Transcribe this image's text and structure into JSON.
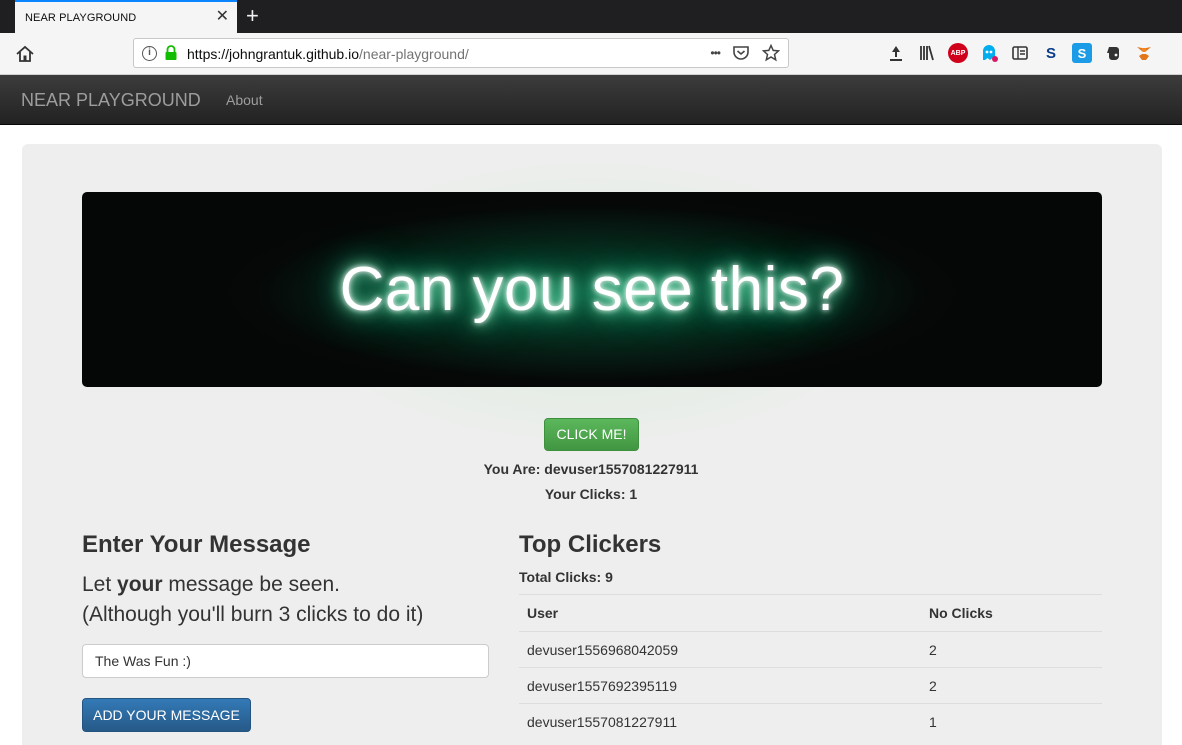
{
  "browser": {
    "tab_title": "NEAR PLAYGROUND",
    "tab_close": "✕",
    "new_tab": "+",
    "url_host": "https://johngrantuk.github.io",
    "url_path": "/near-playground/",
    "url_actions": [
      "•••",
      "pocket-icon",
      "star-icon"
    ],
    "extensions": [
      "download-icon",
      "library-icon",
      "adblock-icon",
      "ghostery-icon",
      "reader-icon",
      "s-icon",
      "s-blue-icon",
      "evernote-icon",
      "metamask-icon"
    ]
  },
  "navbar": {
    "brand": "NEAR PLAYGROUND",
    "about": "About"
  },
  "hero": {
    "banner_text": "Can you see this?",
    "click_button": "CLICK ME!",
    "you_are": "You Are: devuser1557081227911",
    "your_clicks": "Your Clicks: 1"
  },
  "message": {
    "title": "Enter Your Message",
    "sub1_pre": "Let ",
    "sub1_bold": "your",
    "sub1_post": " message be seen.",
    "sub2": "(Although you'll burn 3 clicks to do it)",
    "input_value": "The Was Fun :)",
    "add_button": "ADD YOUR MESSAGE"
  },
  "clickers": {
    "title": "Top Clickers",
    "total": "Total Clicks: 9",
    "headers": [
      "User",
      "No Clicks"
    ],
    "rows": [
      {
        "user": "devuser1556968042059",
        "clicks": "2"
      },
      {
        "user": "devuser1557692395119",
        "clicks": "2"
      },
      {
        "user": "devuser1557081227911",
        "clicks": "1"
      }
    ]
  },
  "colors": {
    "nav_bg": "#222222",
    "jumbotron_bg": "#eeeeee",
    "click_button": "#5cb85c",
    "add_button": "#337ab7",
    "glow": "#2ed99a"
  }
}
